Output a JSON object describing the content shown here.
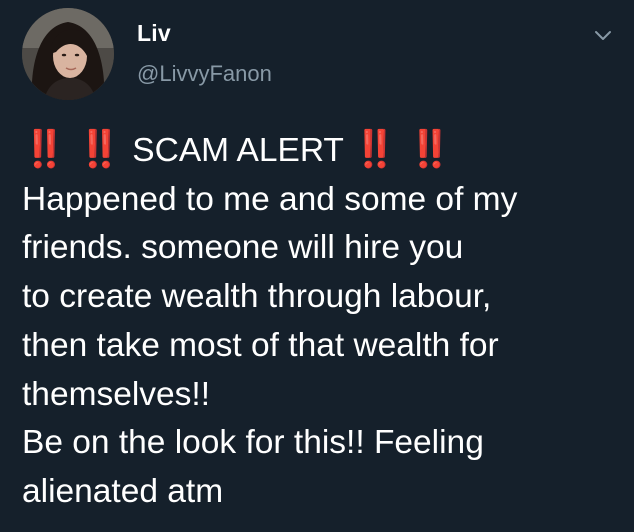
{
  "tweet": {
    "author": {
      "display_name": "Liv",
      "handle": "@LivvyFanon",
      "avatar_icon": "profile-photo"
    },
    "menu_icon": "chevron-down-icon",
    "text": {
      "emoji_bangs": "‼️",
      "alert_label": "SCAM ALERT",
      "lines": [
        "Happened to me and some of my",
        "friends. someone will hire you",
        "to create wealth through labour,",
        "then take most of that wealth for",
        "themselves!!",
        "Be on the look for this!! Feeling",
        "alienated atm"
      ]
    }
  },
  "colors": {
    "background": "#15202b",
    "text_primary": "#ffffff",
    "text_secondary": "#8899a6",
    "emoji_blue": "#2e9ef0"
  }
}
